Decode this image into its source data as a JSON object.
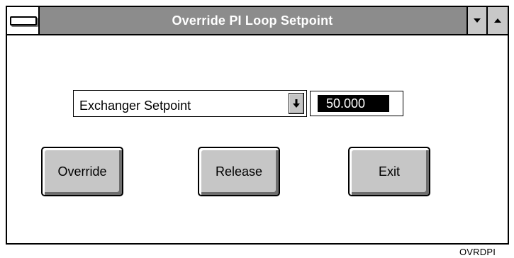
{
  "window": {
    "title": "Override PI Loop Setpoint"
  },
  "setpoint_select": {
    "value": "Exchanger Setpoint"
  },
  "setpoint_value": "50.000",
  "buttons": {
    "override": "Override",
    "release": "Release",
    "exit": "Exit"
  },
  "figure_id": "OVRDPI",
  "icons": {
    "system_menu": "system-menu-icon",
    "minimize": "minimize-arrow-icon",
    "maximize": "maximize-arrow-icon",
    "dropdown": "down-arrow-icon"
  },
  "colors": {
    "titlebar": "#8c8c8c",
    "button_face": "#c6c6c6",
    "value_background": "#000000"
  }
}
